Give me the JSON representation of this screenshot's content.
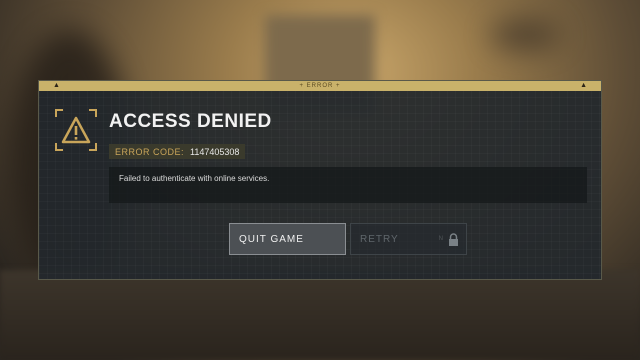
{
  "dialog": {
    "banner_label": "+ ERROR +",
    "title": "ACCESS DENIED",
    "error_code_label": "ERROR CODE:",
    "error_code_value": "1147405308",
    "message": "Failed to authenticate with online services."
  },
  "buttons": {
    "quit_label": "QUIT GAME",
    "retry_label": "RETRY",
    "retry_hint": "N",
    "retry_disabled": true
  },
  "icons": [
    "warning-icon",
    "lock-icon"
  ],
  "colors": {
    "accent": "#c9a55a",
    "banner": "#c9b26a",
    "panel": "#22282c"
  }
}
